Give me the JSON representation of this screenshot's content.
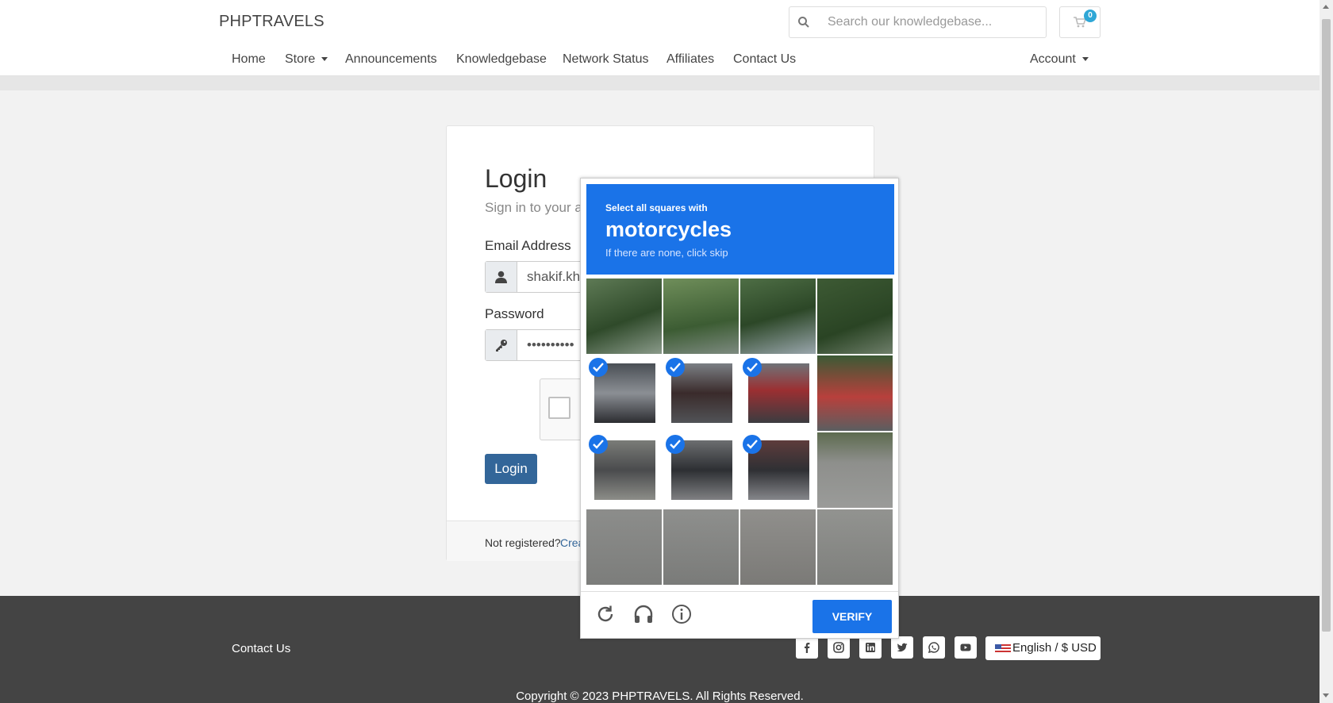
{
  "header": {
    "brand": "PHPTRAVELS",
    "search_placeholder": "Search our knowledgebase...",
    "cart_count": "0",
    "nav": [
      {
        "label": "Home"
      },
      {
        "label": "Store"
      },
      {
        "label": "Announcements"
      },
      {
        "label": "Knowledgebase"
      },
      {
        "label": "Network Status"
      },
      {
        "label": "Affiliates"
      },
      {
        "label": "Contact Us"
      }
    ],
    "account": "Account"
  },
  "login": {
    "title": "Login",
    "subtitle": "Sign in to your a",
    "email_label": "Email Address",
    "email_value": "shakif.kh",
    "password_label": "Password",
    "password_value": "••••••••••",
    "button": "Login",
    "not_registered": "Not registered?",
    "create_link": "Crea"
  },
  "captcha": {
    "line1": "Select all squares with",
    "keyword": "motorcycles",
    "line3": "If there are none, click skip",
    "verify": "VERIFY",
    "selected_tiles": [
      4,
      5,
      6,
      8,
      9,
      10
    ]
  },
  "footer": {
    "contact": "Contact Us",
    "social_icons": [
      "facebook-icon",
      "instagram-icon",
      "linkedin-icon",
      "twitter-icon",
      "whatsapp-icon",
      "youtube-icon"
    ],
    "language": "English / $ USD",
    "copyright": "Copyright © 2023 PHPTRAVELS. All Rights Reserved."
  },
  "colors": {
    "captcha_blue": "#1a73e8",
    "login_button": "#336699",
    "footer_bg": "#444444"
  }
}
